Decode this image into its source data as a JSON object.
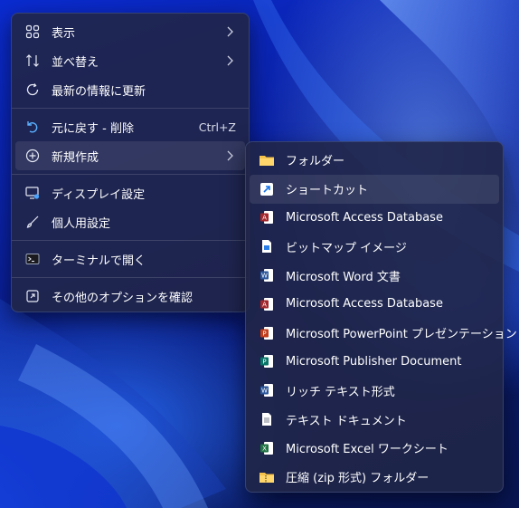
{
  "context_menu": {
    "items": [
      {
        "label": "表示",
        "icon": "grid-view-icon",
        "has_submenu": true
      },
      {
        "label": "並べ替え",
        "icon": "sort-icon",
        "has_submenu": true
      },
      {
        "label": "最新の情報に更新",
        "icon": "refresh-icon",
        "has_submenu": false
      },
      {
        "label": "元に戻す - 削除",
        "icon": "undo-icon",
        "shortcut": "Ctrl+Z"
      },
      {
        "label": "新規作成",
        "icon": "new-plus-icon",
        "has_submenu": true
      },
      {
        "label": "ディスプレイ設定",
        "icon": "display-settings-icon"
      },
      {
        "label": "個人用設定",
        "icon": "brush-icon"
      },
      {
        "label": "ターミナルで開く",
        "icon": "terminal-icon"
      },
      {
        "label": "その他のオプションを確認",
        "icon": "more-options-icon"
      }
    ]
  },
  "new_submenu": {
    "items": [
      {
        "label": "フォルダー",
        "icon": "folder-icon"
      },
      {
        "label": "ショートカット",
        "icon": "shortcut-icon"
      },
      {
        "label": "Microsoft Access Database",
        "icon": "access-icon"
      },
      {
        "label": "ビットマップ イメージ",
        "icon": "bitmap-icon"
      },
      {
        "label": "Microsoft Word 文書",
        "icon": "word-icon"
      },
      {
        "label": "Microsoft Access Database",
        "icon": "access-icon"
      },
      {
        "label": "Microsoft PowerPoint プレゼンテーション",
        "icon": "powerpoint-icon"
      },
      {
        "label": "Microsoft Publisher Document",
        "icon": "publisher-icon"
      },
      {
        "label": "リッチ テキスト形式",
        "icon": "rich-text-icon"
      },
      {
        "label": "テキスト ドキュメント",
        "icon": "text-document-icon"
      },
      {
        "label": "Microsoft Excel ワークシート",
        "icon": "excel-icon"
      },
      {
        "label": "圧縮 (zip 形式) フォルダー",
        "icon": "zip-folder-icon"
      }
    ]
  },
  "colors": {
    "menu_bg": "#202648",
    "access": "#a4262c",
    "word": "#2b579a",
    "powerpoint": "#c43e1c",
    "publisher": "#077568",
    "excel": "#217346",
    "folder": "#f4c14b"
  }
}
